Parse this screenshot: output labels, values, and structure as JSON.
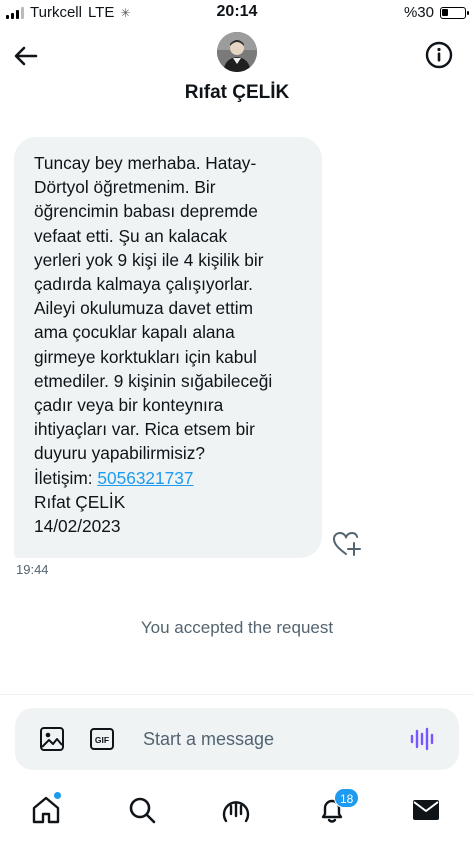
{
  "status_bar": {
    "carrier": "Turkcell",
    "network": "LTE",
    "time": "20:14",
    "battery_text": "%30",
    "battery_level": 0.3
  },
  "header": {
    "contact_name": "Rıfat ÇELİK",
    "back_icon": "arrow-left-icon",
    "info_icon": "info-circle-icon"
  },
  "message": {
    "lines": [
      "Tuncay bey merhaba. Hatay-",
      "Dörtyol öğretmenim. Bir",
      "öğrencimin babası depremde",
      "vefaat etti. Şu an kalacak",
      "yerleri yok 9 kişi ile 4 kişilik bir",
      "çadırda kalmaya çalışıyorlar.",
      "Aileyi okulumuza davet ettim",
      "ama çocuklar kapalı alana",
      "girmeye korktukları için kabul",
      "etmediler. 9 kişinin sığabileceği",
      "çadır veya bir konteynıra",
      "ihtiyaçları var. Rica etsem bir",
      "duyuru yapabilirmisiz?"
    ],
    "contact_label": "İletişim: ",
    "phone": "5056321737",
    "signature": "Rıfat ÇELİK",
    "date": "14/02/2023",
    "time": "19:44"
  },
  "accepted_text": "You accepted the request",
  "composer": {
    "placeholder": "Start a message",
    "value": ""
  },
  "bottom_nav": {
    "items": [
      "home-icon",
      "search-icon",
      "spaces-icon",
      "notifications-icon",
      "messages-icon"
    ],
    "notification_count": "18"
  },
  "colors": {
    "accent": "#1d9bf0",
    "bubble": "#eff3f4",
    "muted_text": "#536471",
    "voice": "#7856ff"
  }
}
